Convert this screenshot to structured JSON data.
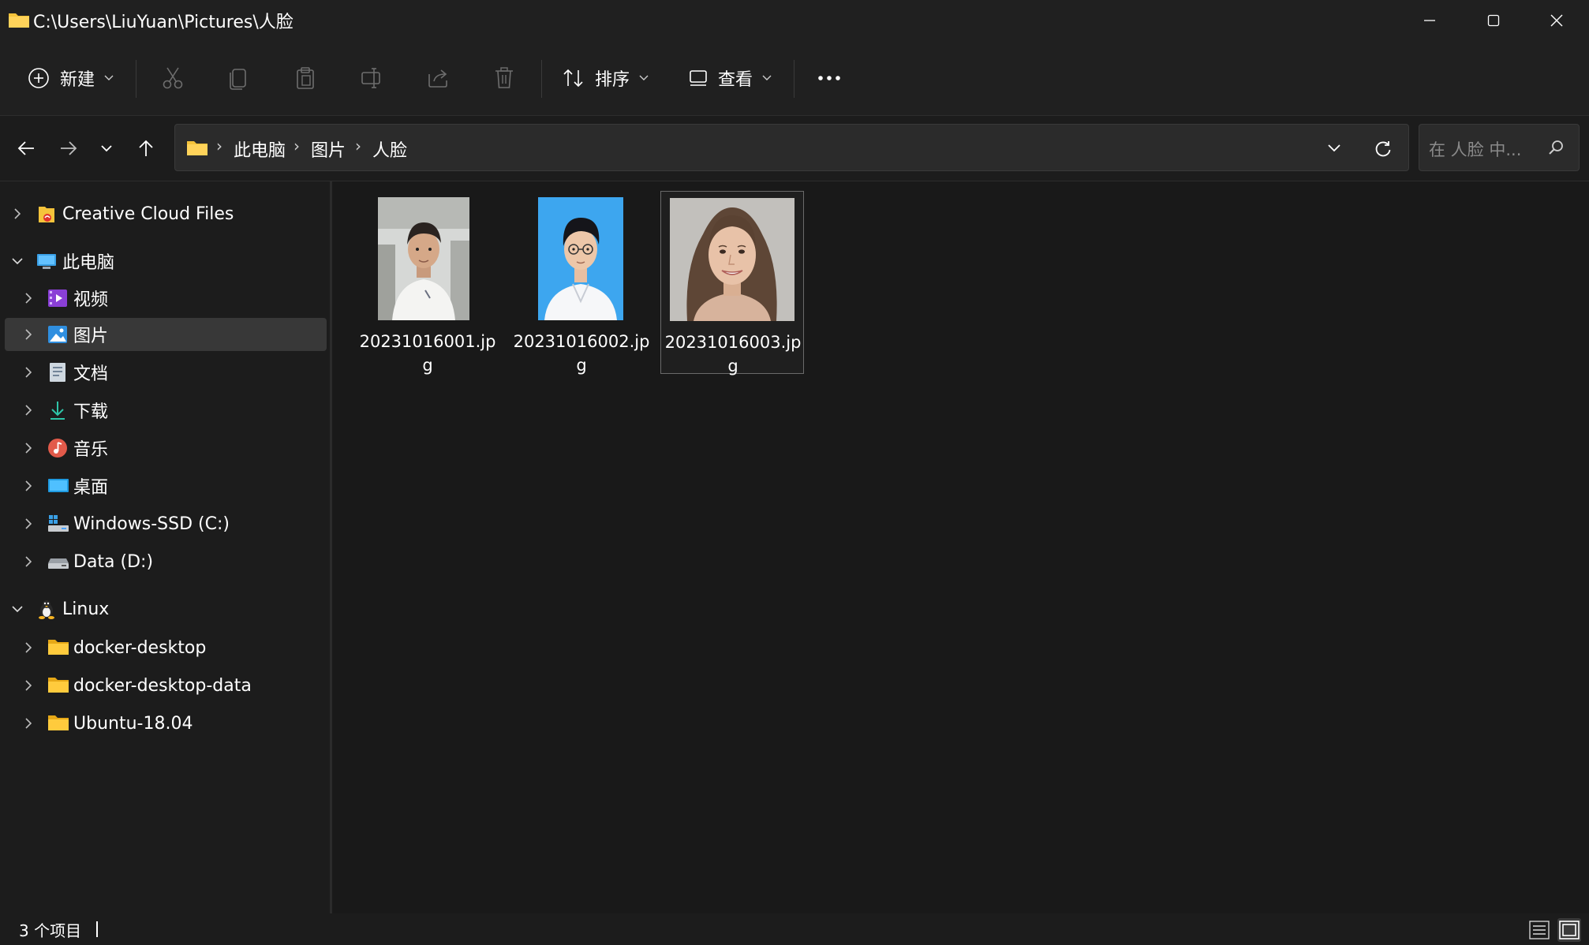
{
  "window": {
    "title": "C:\\Users\\LiuYuan\\Pictures\\人脸"
  },
  "toolbar": {
    "new_label": "新建",
    "sort_label": "排序",
    "view_label": "查看"
  },
  "address": {
    "crumbs": [
      "此电脑",
      "图片",
      "人脸"
    ],
    "search_placeholder": "在 人脸 中..."
  },
  "sidebar": {
    "items": [
      {
        "label": "Creative Cloud Files",
        "icon": "creative-cloud-icon",
        "expanded": false
      },
      {
        "label": "此电脑",
        "icon": "this-pc-icon",
        "expanded": true
      },
      {
        "label": "视频",
        "icon": "videos-icon",
        "expanded": false
      },
      {
        "label": "图片",
        "icon": "pictures-icon",
        "expanded": false,
        "selected": true
      },
      {
        "label": "文档",
        "icon": "documents-icon",
        "expanded": false
      },
      {
        "label": "下载",
        "icon": "downloads-icon",
        "expanded": false
      },
      {
        "label": "音乐",
        "icon": "music-icon",
        "expanded": false
      },
      {
        "label": "桌面",
        "icon": "desktop-icon",
        "expanded": false
      },
      {
        "label": "Windows-SSD (C:)",
        "icon": "drive-c-icon",
        "expanded": false
      },
      {
        "label": "Data (D:)",
        "icon": "drive-d-icon",
        "expanded": false
      },
      {
        "label": "Linux",
        "icon": "linux-icon",
        "expanded": true
      },
      {
        "label": "docker-desktop",
        "icon": "folder-icon",
        "expanded": false
      },
      {
        "label": "docker-desktop-data",
        "icon": "folder-icon",
        "expanded": false
      },
      {
        "label": "Ubuntu-18.04",
        "icon": "folder-icon",
        "expanded": false
      }
    ]
  },
  "files": [
    {
      "name": "20231016001.jpg",
      "selected": false
    },
    {
      "name": "20231016002.jpg",
      "selected": false
    },
    {
      "name": "20231016003.jpg",
      "selected": true
    }
  ],
  "status": {
    "count": "3 个项目"
  },
  "colors": {
    "background": "#191919",
    "chrome": "#202020",
    "accent_folder": "#f5c33b",
    "selection": "#383838"
  }
}
